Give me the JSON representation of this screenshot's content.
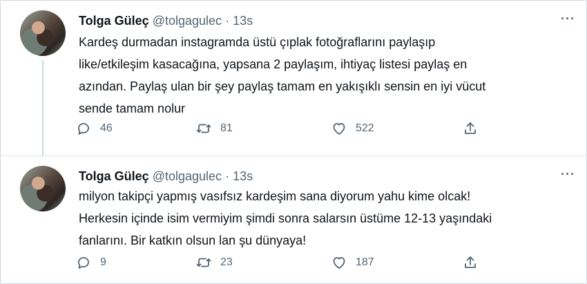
{
  "tweets": [
    {
      "name": "Tolga Güleç",
      "handle": "@tolgagulec",
      "separator": "·",
      "time": "13s",
      "more": "···",
      "lines": [
        "Kardeş durmadan instagramda üstü çıplak fotoğraflarını paylaşıp",
        "like/etkileşim kasacağına, yapsana 2 paylaşım, ihtiyaç listesi paylaş en",
        "azından. Paylaş ulan bir şey paylaş tamam en yakışıklı sensin en iyi vücut",
        "sende tamam nolur"
      ],
      "replies": "46",
      "retweets": "81",
      "likes": "522"
    },
    {
      "name": "Tolga Güleç",
      "handle": "@tolgagulec",
      "separator": "·",
      "time": "13s",
      "more": "···",
      "lines": [
        "milyon takipçi yapmış vasıfsız kardeşim sana diyorum yahu kime olcak!",
        "Herkesin içinde isim vermiyim şimdi sonra salarsın üstüme 12-13 yaşındaki",
        "fanlarını. Bir katkın olsun lan şu dünyaya!"
      ],
      "replies": "9",
      "retweets": "23",
      "likes": "187"
    }
  ],
  "icons": {
    "reply": "reply-icon",
    "retweet": "retweet-icon",
    "like": "heart-icon",
    "share": "share-icon"
  }
}
